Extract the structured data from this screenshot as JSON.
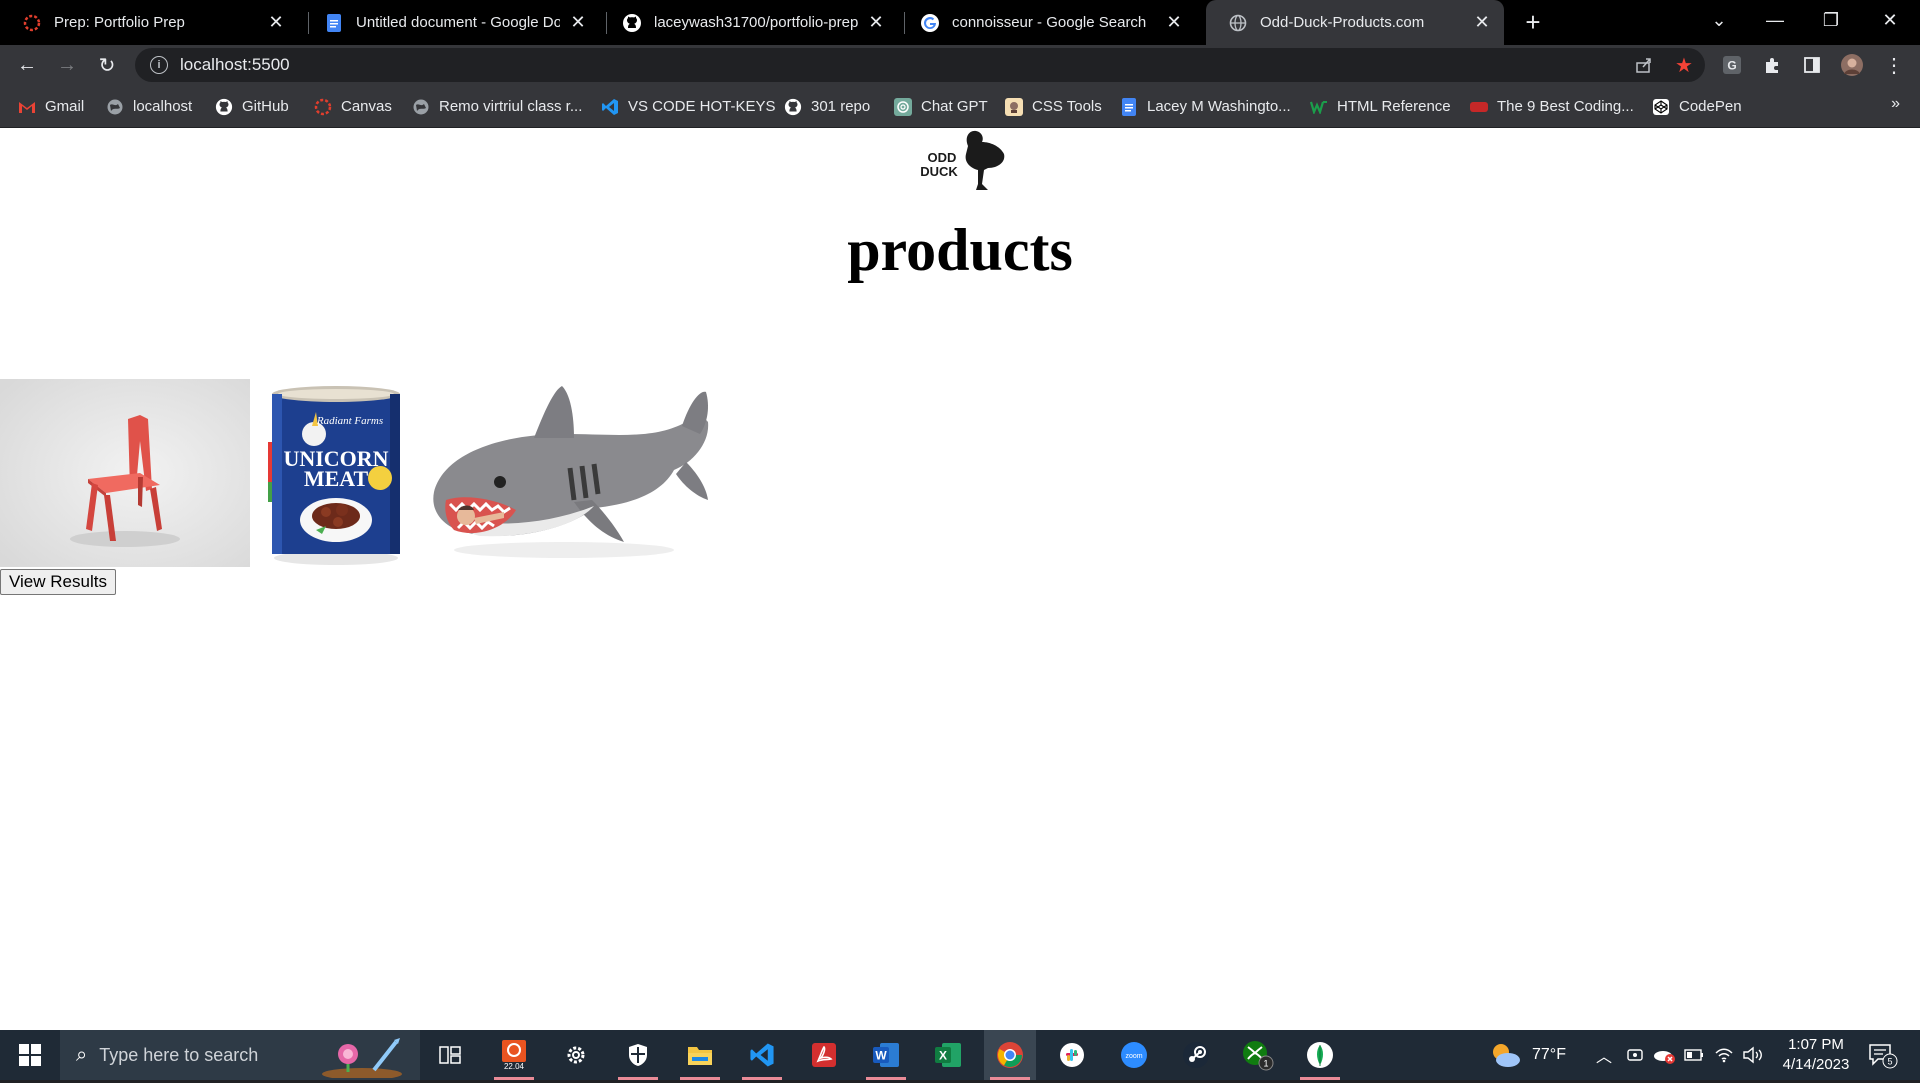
{
  "tabs": [
    {
      "title": "Prep: Portfolio Prep",
      "favicon": "canvas-icon",
      "active": false
    },
    {
      "title": "Untitled document - Google Doc",
      "favicon": "google-docs-icon",
      "active": false
    },
    {
      "title": "laceywash31700/portfolio-prep",
      "favicon": "github-icon",
      "active": false
    },
    {
      "title": "connoisseur - Google Search",
      "favicon": "google-icon",
      "active": false
    },
    {
      "title": "Odd-Duck-Products.com",
      "favicon": "globe-icon",
      "active": true
    }
  ],
  "omnibox": {
    "url": "localhost:5500"
  },
  "bookmarks": [
    {
      "label": "Gmail",
      "icon": "gmail-icon"
    },
    {
      "label": "localhost",
      "icon": "globe-icon"
    },
    {
      "label": "GitHub",
      "icon": "github-icon"
    },
    {
      "label": "Canvas",
      "icon": "canvas-icon"
    },
    {
      "label": "Remo virtriul class r...",
      "icon": "globe-icon"
    },
    {
      "label": "VS CODE HOT-KEYS",
      "icon": "vscode-icon"
    },
    {
      "label": "301 repo",
      "icon": "github-icon"
    },
    {
      "label": "Chat GPT",
      "icon": "chatgpt-icon"
    },
    {
      "label": "CSS Tools",
      "icon": "css-tools-icon"
    },
    {
      "label": "Lacey M Washingto...",
      "icon": "google-docs-icon"
    },
    {
      "label": "HTML Reference",
      "icon": "html-ref-icon"
    },
    {
      "label": "The 9 Best Coding...",
      "icon": "hbo-icon"
    },
    {
      "label": "CodePen",
      "icon": "codepen-icon"
    }
  ],
  "page": {
    "logo_text_line1": "ODD",
    "logo_text_line2": "DUCK",
    "heading": "products",
    "products": [
      {
        "name": "chair",
        "image_text": ""
      },
      {
        "name": "unicorn-meat",
        "image_text_1": "Radiant Farms",
        "image_text_2": "UNICORN",
        "image_text_3": "MEAT"
      },
      {
        "name": "shark-sleeping-bag",
        "image_text": ""
      }
    ],
    "view_results_label": "View Results"
  },
  "taskbar": {
    "search_placeholder": "Type here to search",
    "ubuntu_badge": "22.04",
    "weather": "77°F",
    "time": "1:07 PM",
    "date": "4/14/2023",
    "notification_count": "5",
    "xbox_badge": "1"
  },
  "colors": {
    "tabstrip": "#000000",
    "toolbar": "#35363a",
    "page_bg": "#ffffff",
    "taskbar": "#1f2a36",
    "bookmark_star": "#f44336"
  }
}
